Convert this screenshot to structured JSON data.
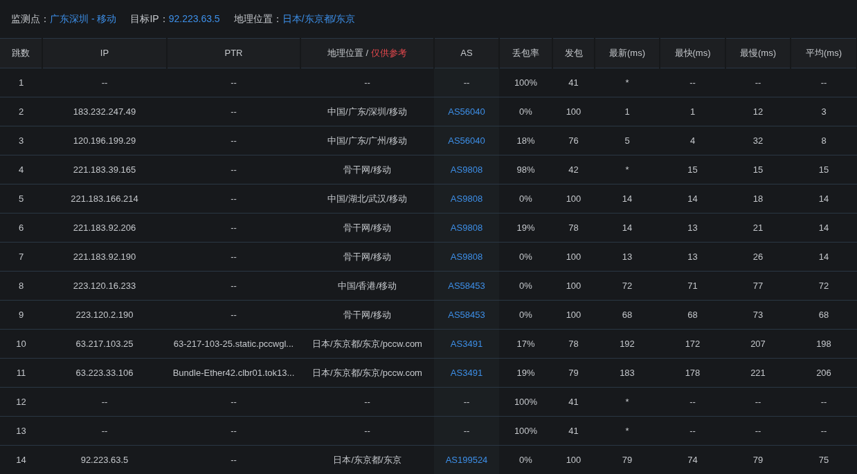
{
  "summary": [
    {
      "label": "监测点：",
      "value": "广东深圳 - 移动"
    },
    {
      "label": "目标IP：",
      "value": "92.223.63.5"
    },
    {
      "label": "地理位置：",
      "value": "日本/东京都/东京"
    }
  ],
  "table": {
    "columns": [
      {
        "label": "跳数"
      },
      {
        "label": "IP"
      },
      {
        "label": "PTR"
      },
      {
        "label": "地理位置 /",
        "note": "仅供参考"
      },
      {
        "label": "AS"
      },
      {
        "label": "丢包率"
      },
      {
        "label": "发包"
      },
      {
        "label": "最新(ms)"
      },
      {
        "label": "最快(ms)"
      },
      {
        "label": "最慢(ms)"
      },
      {
        "label": "平均(ms)"
      }
    ],
    "rows": [
      [
        "1",
        "--",
        "--",
        "--",
        "--",
        "100%",
        "41",
        "*",
        "--",
        "--",
        "--"
      ],
      [
        "2",
        "183.232.247.49",
        "--",
        "中国/广东/深圳/移动",
        "AS56040",
        "0%",
        "100",
        "1",
        "1",
        "12",
        "3"
      ],
      [
        "3",
        "120.196.199.29",
        "--",
        "中国/广东/广州/移动",
        "AS56040",
        "18%",
        "76",
        "5",
        "4",
        "32",
        "8"
      ],
      [
        "4",
        "221.183.39.165",
        "--",
        "骨干网/移动",
        "AS9808",
        "98%",
        "42",
        "*",
        "15",
        "15",
        "15"
      ],
      [
        "5",
        "221.183.166.214",
        "--",
        "中国/湖北/武汉/移动",
        "AS9808",
        "0%",
        "100",
        "14",
        "14",
        "18",
        "14"
      ],
      [
        "6",
        "221.183.92.206",
        "--",
        "骨干网/移动",
        "AS9808",
        "19%",
        "78",
        "14",
        "13",
        "21",
        "14"
      ],
      [
        "7",
        "221.183.92.190",
        "--",
        "骨干网/移动",
        "AS9808",
        "0%",
        "100",
        "13",
        "13",
        "26",
        "14"
      ],
      [
        "8",
        "223.120.16.233",
        "--",
        "中国/香港/移动",
        "AS58453",
        "0%",
        "100",
        "72",
        "71",
        "77",
        "72"
      ],
      [
        "9",
        "223.120.2.190",
        "--",
        "骨干网/移动",
        "AS58453",
        "0%",
        "100",
        "68",
        "68",
        "73",
        "68"
      ],
      [
        "10",
        "63.217.103.25",
        "63-217-103-25.static.pccwgl...",
        "日本/东京都/东京/pccw.com",
        "AS3491",
        "17%",
        "78",
        "192",
        "172",
        "207",
        "198"
      ],
      [
        "11",
        "63.223.33.106",
        "Bundle-Ether42.clbr01.tok13...",
        "日本/东京都/东京/pccw.com",
        "AS3491",
        "19%",
        "79",
        "183",
        "178",
        "221",
        "206"
      ],
      [
        "12",
        "--",
        "--",
        "--",
        "--",
        "100%",
        "41",
        "*",
        "--",
        "--",
        "--"
      ],
      [
        "13",
        "--",
        "--",
        "--",
        "--",
        "100%",
        "41",
        "*",
        "--",
        "--",
        "--"
      ],
      [
        "14",
        "92.223.63.5",
        "--",
        "日本/东京都/东京",
        "AS199524",
        "0%",
        "100",
        "79",
        "74",
        "79",
        "75"
      ]
    ]
  }
}
